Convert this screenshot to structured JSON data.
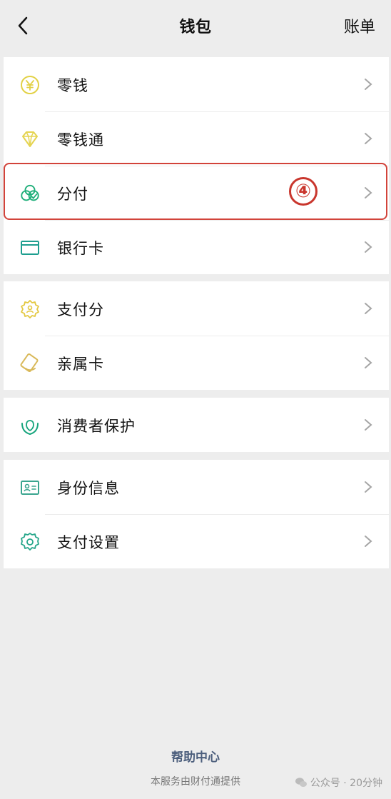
{
  "header": {
    "title": "钱包",
    "right_link": "账单",
    "back_icon": "chevron-left-icon"
  },
  "sections": [
    {
      "items": [
        {
          "label": "零钱",
          "icon": "yuan-coin-icon",
          "icon_color": "#e2d145"
        },
        {
          "label": "零钱通",
          "icon": "diamond-icon",
          "icon_color": "#e5d451"
        },
        {
          "label": "分付",
          "icon": "split-pay-icon",
          "icon_color": "#1fae79"
        },
        {
          "label": "银行卡",
          "icon": "card-icon",
          "icon_color": "#1d9e8f"
        }
      ]
    },
    {
      "items": [
        {
          "label": "支付分",
          "icon": "badge-icon",
          "icon_color": "#e3c841"
        },
        {
          "label": "亲属卡",
          "icon": "family-card-icon",
          "icon_color": "#d9b95a"
        }
      ]
    },
    {
      "items": [
        {
          "label": "消费者保护",
          "icon": "shield-hands-icon",
          "icon_color": "#17a57d"
        }
      ]
    },
    {
      "items": [
        {
          "label": "身份信息",
          "icon": "id-card-icon",
          "icon_color": "#3aa58f"
        },
        {
          "label": "支付设置",
          "icon": "gear-icon",
          "icon_color": "#26a68a"
        }
      ]
    }
  ],
  "annotation": {
    "step_label": "④",
    "highlight_color": "#d2433a"
  },
  "footer": {
    "help": "帮助中心",
    "provider": "本服务由财付通提供",
    "watermark": "公众号 · 20分钟"
  }
}
